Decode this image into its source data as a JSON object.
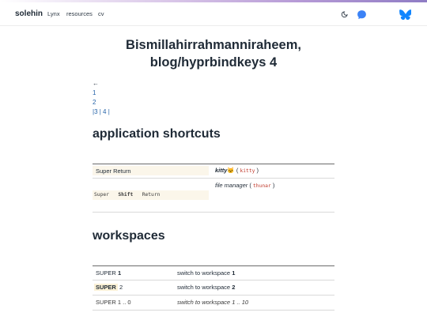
{
  "nav": {
    "brand": "solehin",
    "links": [
      "Lynx",
      "resources",
      "cv"
    ]
  },
  "icons": {
    "theme": "moon-icon",
    "chat": "chat-bubble-icon",
    "social": "bluesky-butterfly-icon"
  },
  "colors": {
    "accent_link": "#2563a8",
    "chat_blue": "#3b82f6",
    "bluesky_blue": "#1185fe",
    "code_red": "#c0392b",
    "highlight": "#fbf1d6"
  },
  "title": {
    "line1": "Bismillahirrahmanniraheem,",
    "line2": "blog/hyprbindkeys 4"
  },
  "pager": {
    "first": "←",
    "items": [
      "1",
      "2"
    ],
    "current_line": "|3 | 4 |"
  },
  "app_section": {
    "heading": "application shortcuts",
    "rows": [
      {
        "key": "Super Return",
        "app": "kitty",
        "emoji": "🐱",
        "open": "(",
        "cmd": "kitty",
        "close": ")"
      },
      {
        "app": "file manager",
        "open": "(",
        "cmd": "thunar",
        "close": ")",
        "keys": [
          "Super",
          "Shift",
          "Return"
        ]
      }
    ]
  },
  "ws_section": {
    "heading": "workspaces",
    "rows": [
      {
        "mod": "SUPER",
        "num": "1",
        "desc": "switch to workspace",
        "target": "1"
      },
      {
        "mod": "SUPER",
        "num": "2",
        "desc": "switch to workspace",
        "target": "2"
      },
      {
        "key": "SUPER 1 .. 0",
        "desc": "switch to workspace 1 .. 10"
      }
    ]
  }
}
